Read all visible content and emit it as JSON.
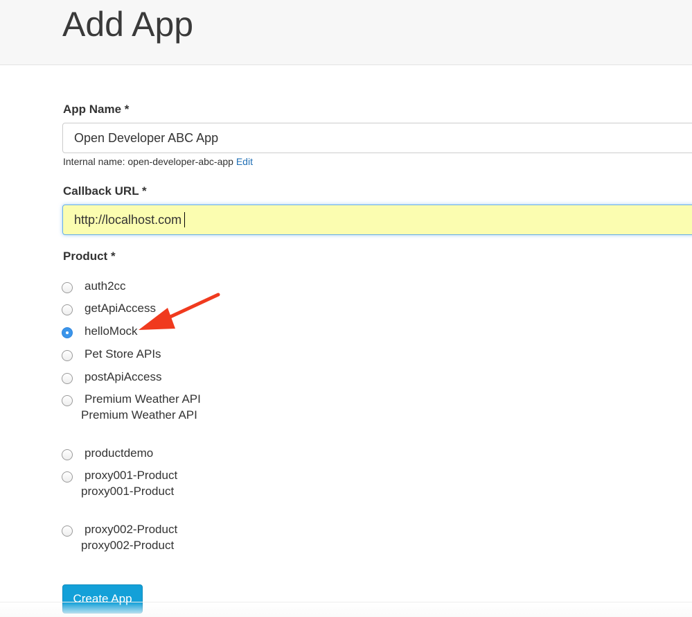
{
  "header": {
    "title": "Add App"
  },
  "form": {
    "app_name": {
      "label": "App Name *",
      "value": "Open Developer ABC App",
      "internal_name_text": "Internal name: open-developer-abc-app",
      "edit_link": "Edit"
    },
    "callback_url": {
      "label": "Callback URL *",
      "value": "http://localhost.com"
    },
    "product": {
      "label": "Product *",
      "options": [
        {
          "label": "auth2cc",
          "description": "",
          "checked": false
        },
        {
          "label": "getApiAccess",
          "description": "",
          "checked": false
        },
        {
          "label": "helloMock",
          "description": "",
          "checked": true
        },
        {
          "label": "Pet Store APIs",
          "description": "",
          "checked": false
        },
        {
          "label": "postApiAccess",
          "description": "",
          "checked": false
        },
        {
          "label": "Premium Weather API",
          "description": "Premium Weather API",
          "checked": false
        },
        {
          "label": "productdemo",
          "description": "",
          "checked": false
        },
        {
          "label": "proxy001-Product",
          "description": "proxy001-Product",
          "checked": false
        },
        {
          "label": "proxy002-Product",
          "description": "proxy002-Product",
          "checked": false
        }
      ]
    },
    "submit_label": "Create App"
  },
  "annotation": {
    "arrow_color": "#f03a1e"
  },
  "colors": {
    "accent": "#13a0d8",
    "link": "#1f6fb5",
    "focused_input_bg": "#fbfdb0"
  }
}
